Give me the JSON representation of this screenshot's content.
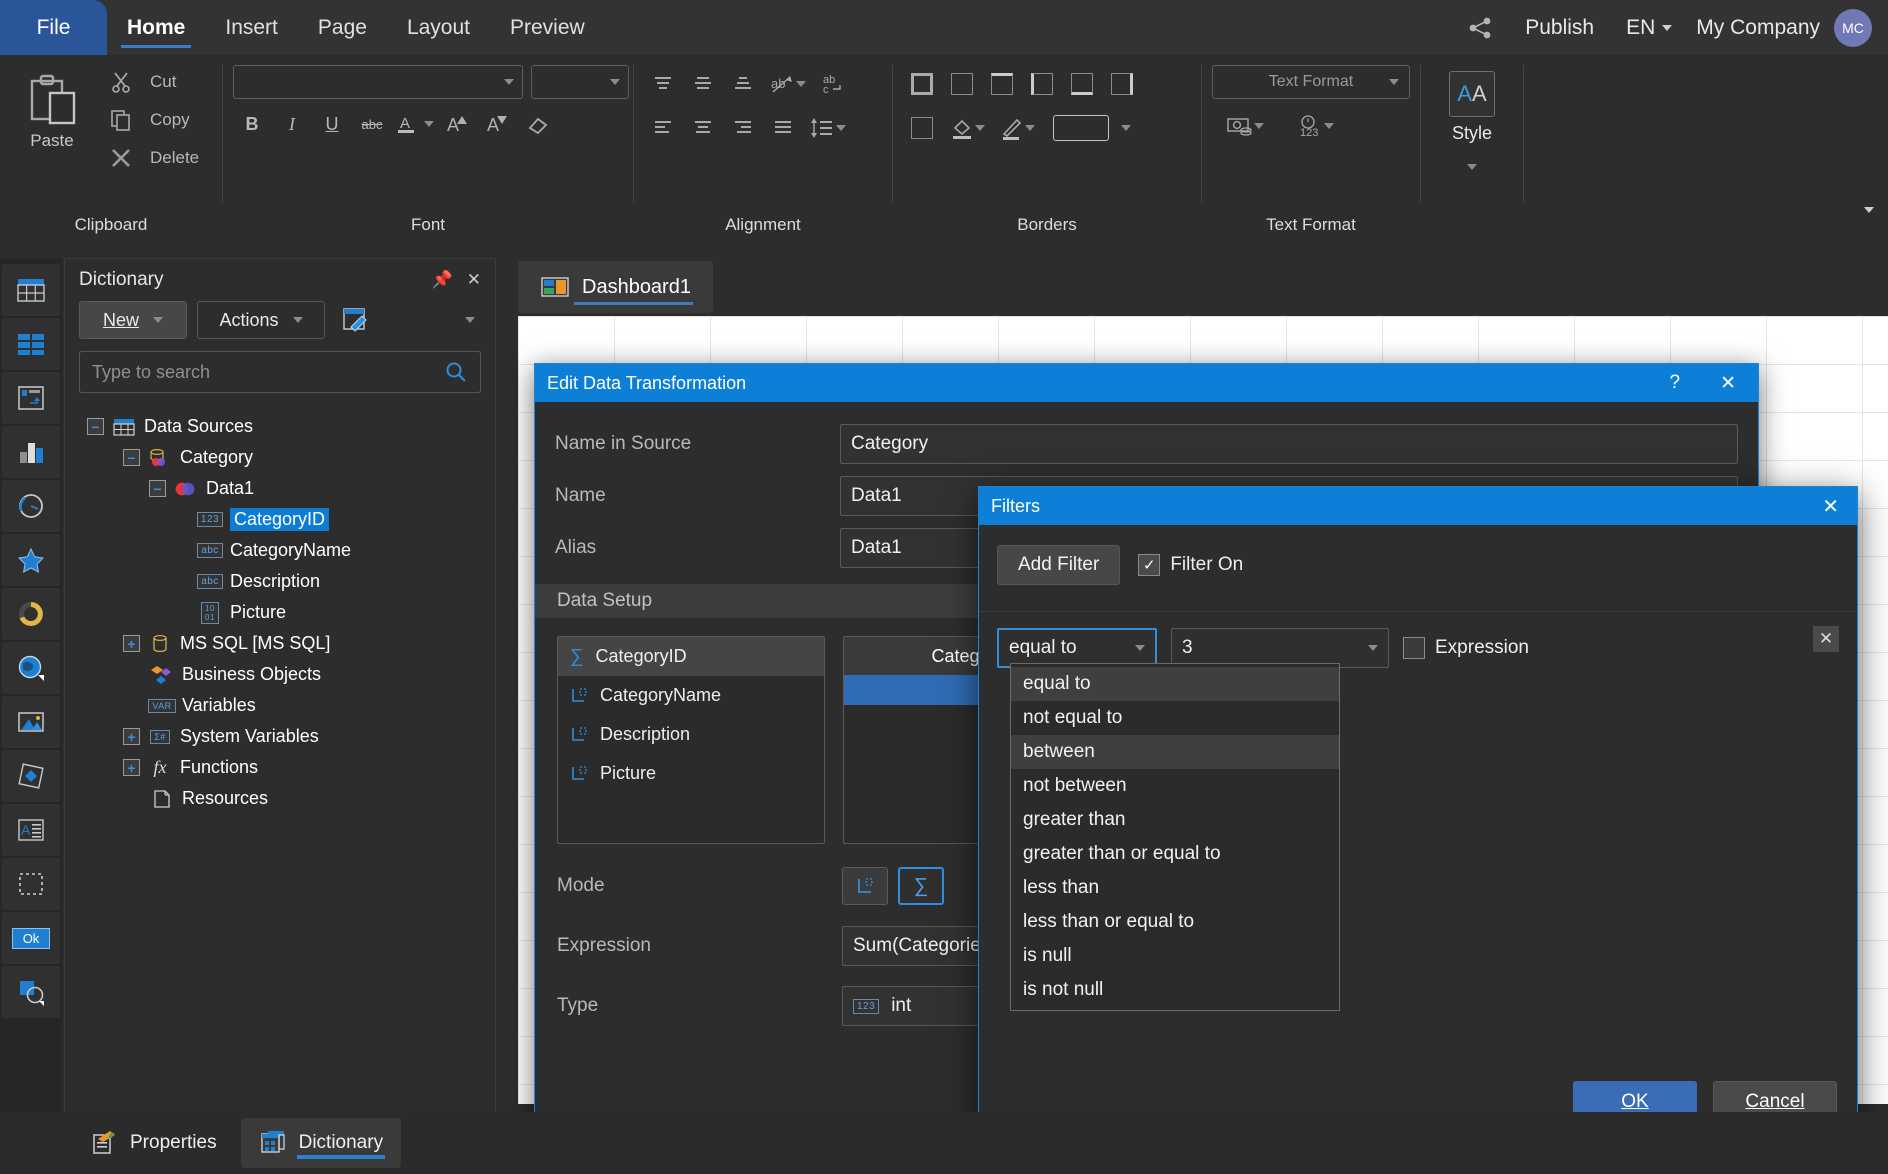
{
  "menubar": {
    "file": "File",
    "items": [
      "Home",
      "Insert",
      "Page",
      "Layout",
      "Preview"
    ],
    "active": "Home",
    "share_icon": "share-icon",
    "publish": "Publish",
    "language": "EN",
    "company": "My Company",
    "avatar_initials": "MC"
  },
  "ribbon": {
    "groups": [
      {
        "name": "Clipboard",
        "label": "Clipboard"
      },
      {
        "name": "Font",
        "label": "Font"
      },
      {
        "name": "Alignment",
        "label": "Alignment"
      },
      {
        "name": "Borders",
        "label": "Borders"
      },
      {
        "name": "TextFormat",
        "label": "Text Format"
      }
    ],
    "clipboard": {
      "paste": "Paste",
      "cut": "Cut",
      "copy": "Copy",
      "delete": "Delete"
    },
    "font": {
      "family_value": "",
      "size_value": "",
      "bold": "B",
      "italic": "I",
      "underline": "U",
      "strike": "abc"
    },
    "text_format": {
      "combo_value": "Text Format"
    },
    "style": {
      "label": "Style",
      "glyph": "AA"
    }
  },
  "rail": {
    "items": [
      {
        "name": "table-icon"
      },
      {
        "name": "grid-blocks-icon"
      },
      {
        "name": "cross-tab-icon"
      },
      {
        "name": "bar-chart-icon"
      },
      {
        "name": "gauge-icon"
      },
      {
        "name": "star-indicator-icon"
      },
      {
        "name": "progress-ring-icon"
      },
      {
        "name": "map-globe-icon"
      },
      {
        "name": "image-icon"
      },
      {
        "name": "shape-icon"
      },
      {
        "name": "richtext-icon"
      },
      {
        "name": "panel-icon"
      },
      {
        "name": "button-ok-icon"
      },
      {
        "name": "overlay-shapes-icon"
      }
    ],
    "ok_label": "Ok"
  },
  "dictionary": {
    "title": "Dictionary",
    "new_button": "New",
    "actions_button": "Actions",
    "search_placeholder": "Type to search",
    "search_value": "",
    "tree": [
      {
        "label": "Data Sources",
        "indent": 0,
        "expander": "-",
        "icon": "datasources-icon",
        "selected": false
      },
      {
        "label": "Category",
        "indent": 1,
        "expander": "-",
        "icon": "datasource-icon",
        "selected": false
      },
      {
        "label": "Data1",
        "indent": 2,
        "expander": "-",
        "icon": "datatable-icon",
        "selected": false
      },
      {
        "label": "CategoryID",
        "indent": 3,
        "expander": "",
        "icon": "int-field-icon",
        "selected": true
      },
      {
        "label": "CategoryName",
        "indent": 3,
        "expander": "",
        "icon": "string-field-icon",
        "selected": false
      },
      {
        "label": "Description",
        "indent": 3,
        "expander": "",
        "icon": "string-field-icon",
        "selected": false
      },
      {
        "label": "Picture",
        "indent": 3,
        "expander": "",
        "icon": "binary-field-icon",
        "selected": false
      },
      {
        "label": "MS SQL [MS SQL]",
        "indent": 1,
        "expander": "+",
        "icon": "database-icon",
        "selected": false
      },
      {
        "label": "Business Objects",
        "indent": 1,
        "expander": "",
        "icon": "business-objects-icon",
        "selected": false
      },
      {
        "label": "Variables",
        "indent": 1,
        "expander": "",
        "icon": "variables-icon",
        "selected": false
      },
      {
        "label": "System Variables",
        "indent": 1,
        "expander": "+",
        "icon": "system-variables-icon",
        "selected": false
      },
      {
        "label": "Functions",
        "indent": 1,
        "expander": "+",
        "icon": "functions-icon",
        "selected": false
      },
      {
        "label": "Resources",
        "indent": 1,
        "expander": "",
        "icon": "resources-icon",
        "selected": false
      }
    ]
  },
  "document": {
    "tab_label": "Dashboard1",
    "tab_icon": "dashboard-icon"
  },
  "statusbar": {
    "properties": "Properties",
    "dictionary": "Dictionary",
    "active": "Dictionary"
  },
  "edit_transform": {
    "title": "Edit Data Transformation",
    "help_glyph": "?",
    "close_glyph": "✕",
    "fields": [
      {
        "label": "Name in Source",
        "value": "Category"
      },
      {
        "label": "Name",
        "value": "Data1"
      },
      {
        "label": "Alias",
        "value": "Data1"
      }
    ],
    "data_setup_header": "Data Setup",
    "columns_list": [
      {
        "label": "CategoryID",
        "mode": "aggregate",
        "selected": true
      },
      {
        "label": "CategoryName",
        "mode": "dimension",
        "selected": false
      },
      {
        "label": "Description",
        "mode": "dimension",
        "selected": false
      },
      {
        "label": "Picture",
        "mode": "dimension",
        "selected": false
      }
    ],
    "preview_header": "CategoryID",
    "mode_label": "Mode",
    "expression_label": "Expression",
    "expression_value": "Sum(Categories.C",
    "type_label": "Type",
    "type_value": "int",
    "type_icon": "int-field-icon"
  },
  "filters": {
    "title": "Filters",
    "close_glyph": "✕",
    "add_filter": "Add Filter",
    "filter_on_label": "Filter On",
    "filter_on_checked": true,
    "row": {
      "condition_value": "equal to",
      "value_value": "3",
      "expression_label": "Expression",
      "expression_checked": false,
      "remove_glyph": "✕"
    },
    "dropdown_options": [
      "equal to",
      "not equal to",
      "between",
      "not between",
      "greater than",
      "greater than or equal to",
      "less than",
      "less than or equal to",
      "is null",
      "is not null"
    ],
    "dropdown_selected": "equal to",
    "dropdown_hover": "between",
    "ok": "OK",
    "cancel": "Cancel"
  }
}
